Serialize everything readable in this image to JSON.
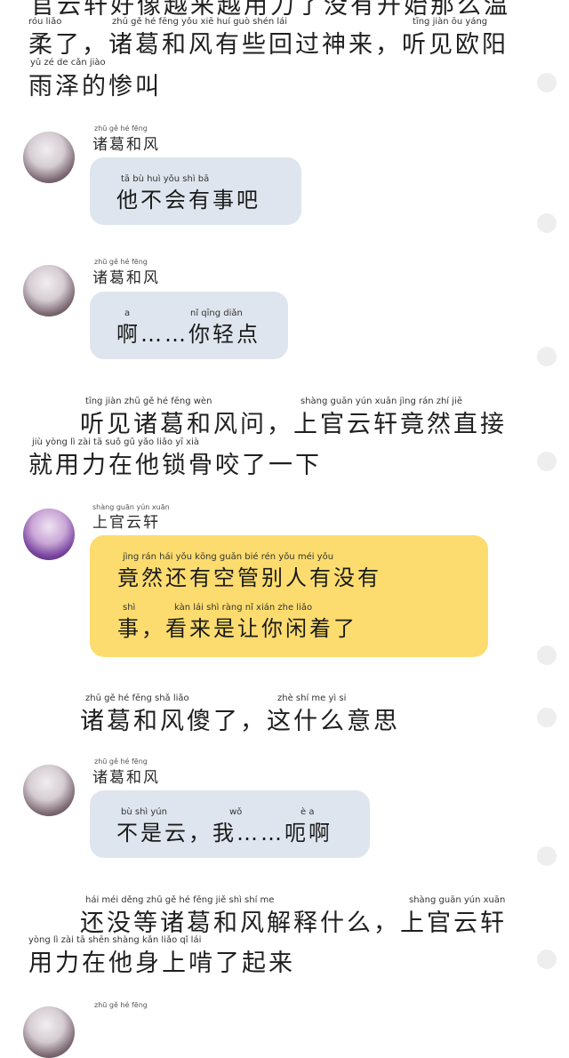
{
  "narration_1": {
    "line_top": "官云轩好像越来越用力了没有开始那么温",
    "line_a": "柔了，诸葛和风有些回过神来，听见欧阳",
    "line_b": "雨泽的惨叫",
    "pinyin_a": "róu liǎo",
    "pinyin_a2": "zhū gě hé fēng yǒu xiē huí guò shén lái",
    "pinyin_a3": "tīng jiàn ōu yáng",
    "pinyin_b": "yǔ zé de cǎn jiào"
  },
  "msg1": {
    "speaker": "诸葛和风",
    "speaker_pinyin": "zhū gě hé fēng",
    "text": "他不会有事吧",
    "pinyin": "tā bù huì yǒu shì bā"
  },
  "msg2": {
    "speaker": "诸葛和风",
    "speaker_pinyin": "zhū gě hé fēng",
    "text": "啊……你轻点",
    "pinyin_a": "a",
    "pinyin_b": "nǐ qīng diǎn"
  },
  "narration_2": {
    "line_a": "听见诸葛和风问，上官云轩竟然直接",
    "line_b": "就用力在他锁骨咬了一下",
    "pinyin_a1": "tīng jiàn zhū gě hé fēng wèn",
    "pinyin_a2": "shàng guān yún xuān jìng rán zhí jiē",
    "pinyin_b": "jiù yòng lì zài tā suǒ gǔ yǎo liǎo yī xià"
  },
  "msg3": {
    "speaker": "上官云轩",
    "speaker_pinyin": "shàng guān yún xuān",
    "line_a": "竟然还有空管别人有没有",
    "line_b": "事，看来是让你闲着了",
    "pinyin_a": "jìng rán hái yǒu kōng guǎn bié rén yǒu méi yǒu",
    "pinyin_b1": "shì",
    "pinyin_b2": "kàn lái shì ràng nǐ xián zhe liǎo"
  },
  "narration_3": {
    "line": "诸葛和风傻了，这什么意思",
    "pinyin_a": "zhū gě hé fēng shǎ liǎo",
    "pinyin_b": "zhè shí me yì si"
  },
  "msg4": {
    "speaker": "诸葛和风",
    "speaker_pinyin": "zhū gě hé fēng",
    "text": "不是云，我……呃啊",
    "pinyin_a": "bù shì yún",
    "pinyin_b": "wǒ",
    "pinyin_c": "è a"
  },
  "narration_4": {
    "line_a": "还没等诸葛和风解释什么，上官云轩",
    "line_b": "用力在他身上啃了起来",
    "pinyin_a1": "hái méi děng zhū gě hé fēng jiě shì shí me",
    "pinyin_a2": "shàng guān yún xuān",
    "pinyin_b": "yòng lì zài tā shēn shàng kǎn liǎo qǐ lái"
  },
  "msg5": {
    "speaker_pinyin": "zhū gě hé fēng"
  }
}
